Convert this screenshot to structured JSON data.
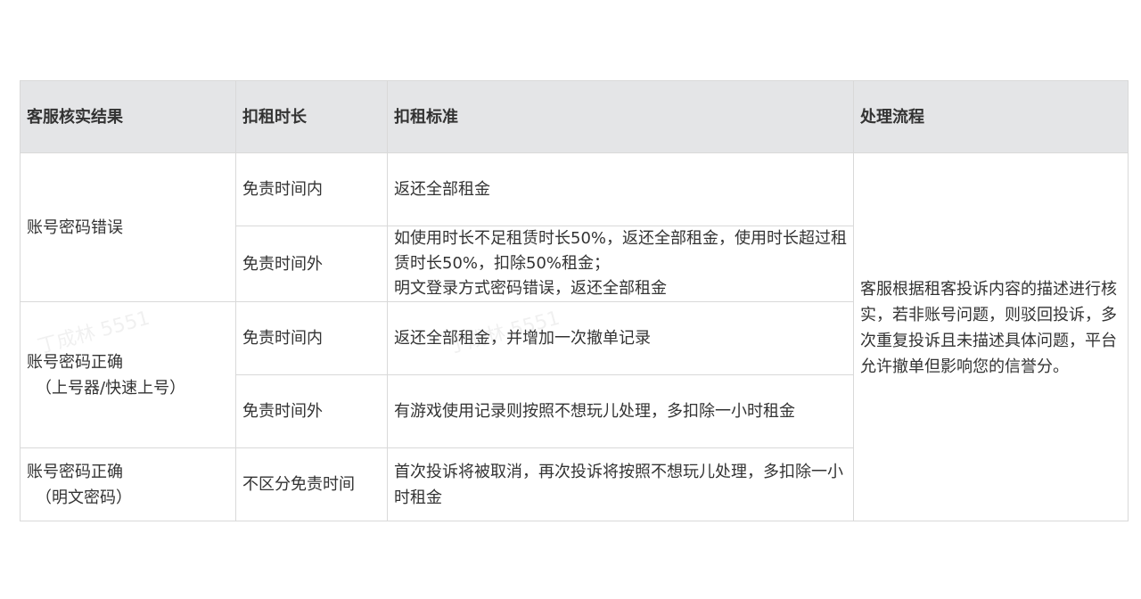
{
  "table": {
    "headers": [
      "客服核实结果",
      "扣租时长",
      "扣租标准",
      "处理流程"
    ],
    "rows": [
      {
        "result_lines": [
          "账号密码错误"
        ],
        "duration": "免责时间内",
        "standard_lines": [
          "返还全部租金"
        ]
      },
      {
        "duration": "免责时间外",
        "standard_lines": [
          "如使用时长不足租赁时长50%，返还全部租金，使用时长超过租赁时长50%，扣除50%租金；",
          "明文登录方式密码错误，返还全部租金"
        ]
      },
      {
        "result_lines": [
          "账号密码正确",
          "（上号器/快速上号）"
        ],
        "duration": "免责时间内",
        "standard_lines": [
          "返还全部租金，并增加一次撤单记录"
        ]
      },
      {
        "duration": "免责时间外",
        "standard_lines": [
          "有游戏使用记录则按照不想玩儿处理，多扣除一小时租金"
        ]
      },
      {
        "result_lines": [
          "账号密码正确",
          "（明文密码）"
        ],
        "duration": "不区分免责时间",
        "standard_lines": [
          "首次投诉将被取消，再次投诉将按照不想玩儿处理，多扣除一小时租金"
        ]
      }
    ],
    "process": "客服根据租客投诉内容的描述进行核实，若非账号问题，则驳回投诉，多次重复投诉且未描述具体问题，平台允许撤单但影响您的信誉分。"
  },
  "watermark_text": "丁成林 5551"
}
